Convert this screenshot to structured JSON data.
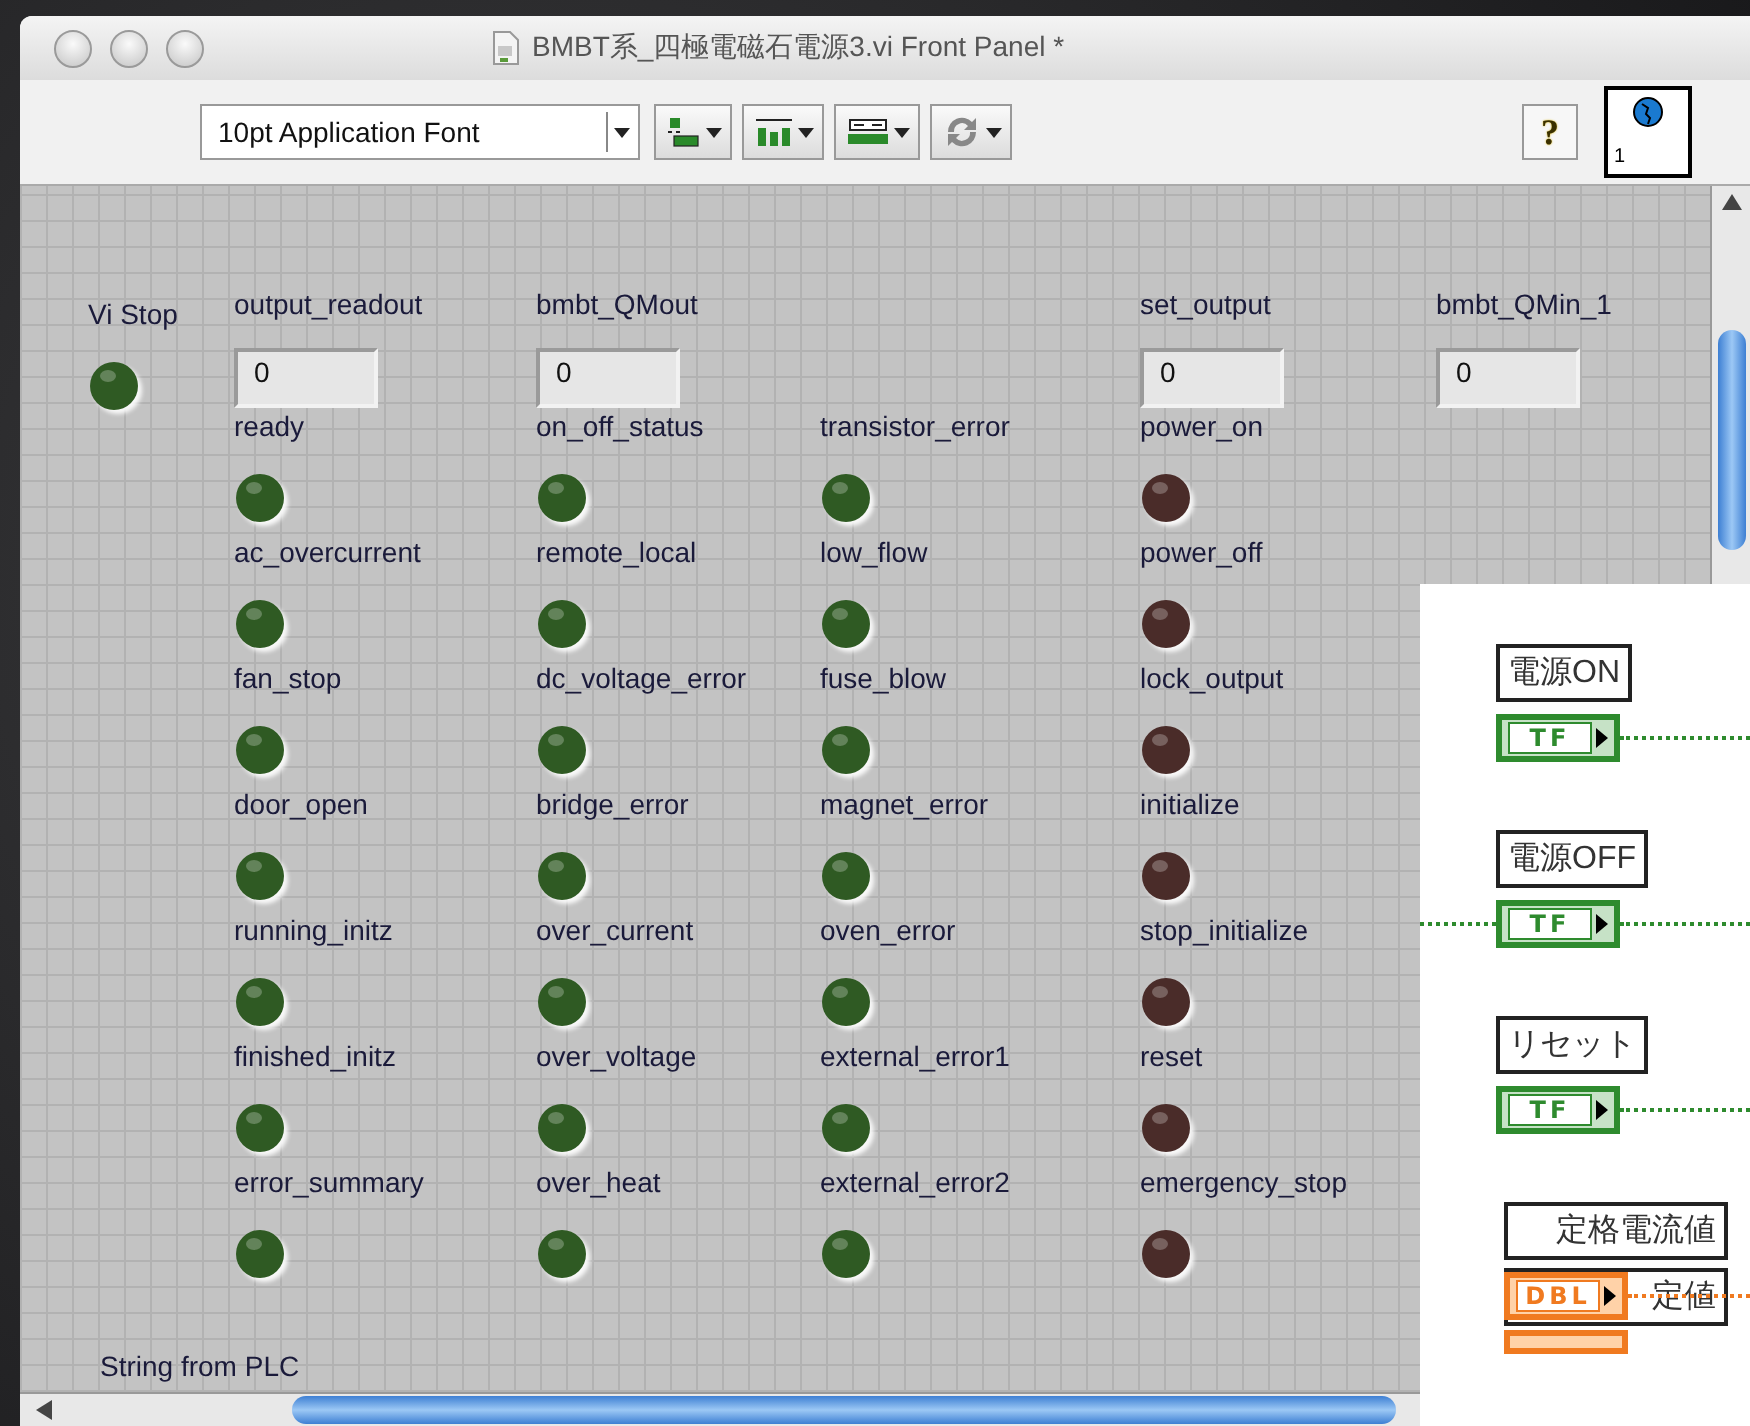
{
  "window": {
    "title": "BMBT系_四極電磁石電源3.vi Front Panel *"
  },
  "toolbar": {
    "font_menu": "10pt Application Font",
    "tools": [
      {
        "kind": "align"
      },
      {
        "kind": "distribute"
      },
      {
        "kind": "resize"
      },
      {
        "kind": "reorder"
      }
    ],
    "help": "?",
    "vi_icon_number": "1"
  },
  "panel": {
    "stop": {
      "label": "Vi Stop",
      "color": "#2f5a23"
    },
    "columns": [
      {
        "header": {
          "label": "output_readout",
          "value": "0"
        },
        "indicators": [
          {
            "label": "ready",
            "color": "#2f5a23"
          },
          {
            "label": "ac_overcurrent",
            "color": "#2f5a23"
          },
          {
            "label": "fan_stop",
            "color": "#2f5a23"
          },
          {
            "label": "door_open",
            "color": "#2f5a23"
          },
          {
            "label": "running_initz",
            "color": "#2f5a23"
          },
          {
            "label": "finished_initz",
            "color": "#2f5a23"
          },
          {
            "label": "error_summary",
            "color": "#2f5a23"
          }
        ]
      },
      {
        "header": {
          "label": "bmbt_QMout",
          "value": "0"
        },
        "indicators": [
          {
            "label": "on_off_status",
            "color": "#2f5a23"
          },
          {
            "label": "remote_local",
            "color": "#2f5a23"
          },
          {
            "label": "dc_voltage_error",
            "color": "#2f5a23"
          },
          {
            "label": "bridge_error",
            "color": "#2f5a23"
          },
          {
            "label": "over_current",
            "color": "#2f5a23"
          },
          {
            "label": "over_voltage",
            "color": "#2f5a23"
          },
          {
            "label": "over_heat",
            "color": "#2f5a23"
          }
        ]
      },
      {
        "indicators": [
          {
            "label": "transistor_error",
            "color": "#2f5a23"
          },
          {
            "label": "low_flow",
            "color": "#2f5a23"
          },
          {
            "label": "fuse_blow",
            "color": "#2f5a23"
          },
          {
            "label": "magnet_error",
            "color": "#2f5a23"
          },
          {
            "label": "oven_error",
            "color": "#2f5a23"
          },
          {
            "label": "external_error1",
            "color": "#2f5a23"
          },
          {
            "label": "external_error2",
            "color": "#2f5a23"
          }
        ]
      },
      {
        "header": {
          "label": "set_output",
          "value": "0"
        },
        "indicators": [
          {
            "label": "power_on",
            "color": "#4a2c29"
          },
          {
            "label": "power_off",
            "color": "#4a2c29"
          },
          {
            "label": "lock_output",
            "color": "#4a2c29"
          },
          {
            "label": "initialize",
            "color": "#4a2c29"
          },
          {
            "label": "stop_initialize",
            "color": "#4a2c29"
          },
          {
            "label": "reset",
            "color": "#4a2c29"
          },
          {
            "label": "emergency_stop",
            "color": "#4a2c29"
          }
        ]
      },
      {
        "header": {
          "label": "bmbt_QMin_1",
          "value": "0"
        }
      }
    ],
    "string_label": "String from PLC"
  },
  "block_diagram": {
    "items": [
      {
        "label": "電源ON",
        "kind": "boolean",
        "terminal": "TF",
        "wire_in": false
      },
      {
        "label": "電源OFF",
        "kind": "boolean",
        "terminal": "TF",
        "wire_in": true
      },
      {
        "label": "リセット",
        "kind": "boolean",
        "terminal": "TF",
        "wire_in": false
      },
      {
        "label": "定格電流値",
        "kind": "numeric",
        "terminal": "DBL",
        "wire_in": false
      },
      {
        "label": "定値",
        "kind": "numeric_hidden",
        "wire_in": false
      }
    ]
  }
}
